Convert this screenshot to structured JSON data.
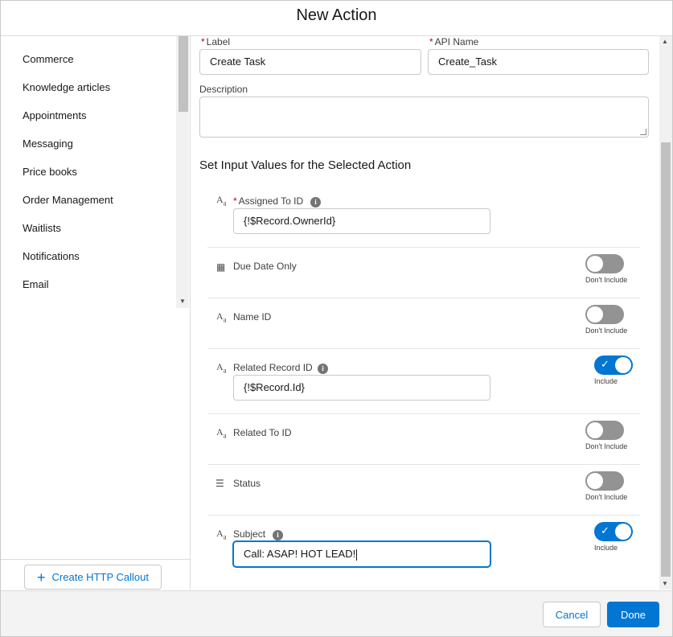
{
  "header": {
    "title": "New Action"
  },
  "left_panel": {
    "items": [
      {
        "label": "Commerce"
      },
      {
        "label": "Knowledge articles"
      },
      {
        "label": "Appointments"
      },
      {
        "label": "Messaging"
      },
      {
        "label": "Price books"
      },
      {
        "label": "Order Management"
      },
      {
        "label": "Waitlists"
      },
      {
        "label": "Notifications"
      },
      {
        "label": "Email"
      }
    ],
    "create_http_callout": "Create HTTP Callout"
  },
  "form": {
    "label_field": {
      "label": "Label",
      "value": "Create Task"
    },
    "api_name_field": {
      "label": "API Name",
      "value": "Create_Task"
    },
    "description_field": {
      "label": "Description",
      "value": ""
    },
    "section_title": "Set Input Values for the Selected Action",
    "inputs": [
      {
        "name": "Assigned To ID",
        "required": true,
        "value": "{!$Record.OwnerId}"
      },
      {
        "name": "Due Date Only",
        "toggle": "off",
        "toggle_label": "Don't Include"
      },
      {
        "name": "Name ID",
        "toggle": "off",
        "toggle_label": "Don't Include"
      },
      {
        "name": "Related Record ID",
        "toggle": "on",
        "toggle_label": "Include",
        "value": "{!$Record.Id}"
      },
      {
        "name": "Related To ID",
        "toggle": "off",
        "toggle_label": "Don't Include"
      },
      {
        "name": "Status",
        "toggle": "off",
        "toggle_label": "Don't Include"
      },
      {
        "name": "Subject",
        "toggle": "on",
        "toggle_label": "Include",
        "value": "Call: ASAP! HOT LEAD!"
      }
    ]
  },
  "footer": {
    "cancel_label": "Cancel",
    "done_label": "Done"
  },
  "colors": {
    "brand": "#0176d3",
    "required": "#ba0517",
    "toggle_off": "#939393"
  }
}
